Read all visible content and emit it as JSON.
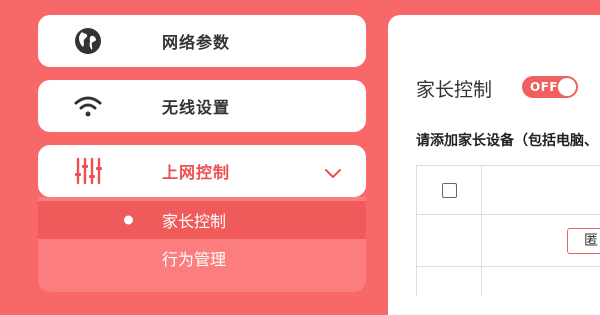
{
  "sidebar": {
    "items": [
      {
        "label": "网络参数",
        "icon": "globe-icon"
      },
      {
        "label": "无线设置",
        "icon": "wifi-icon"
      },
      {
        "label": "上网控制",
        "icon": "sliders-icon",
        "expanded": true
      }
    ],
    "submenu": [
      {
        "label": "家长控制",
        "active": true
      },
      {
        "label": "行为管理",
        "active": false
      }
    ]
  },
  "main": {
    "title": "家长控制",
    "toggle": {
      "label": "OFF",
      "state": "off"
    },
    "instruction": "请添加家长设备（包括电脑、",
    "table": {
      "edit_button": "匿"
    }
  },
  "colors": {
    "background": "#f96868",
    "accent": "#f04e4e",
    "submenu_bg": "#fb7d7d",
    "submenu_active": "#ef5a5a"
  }
}
